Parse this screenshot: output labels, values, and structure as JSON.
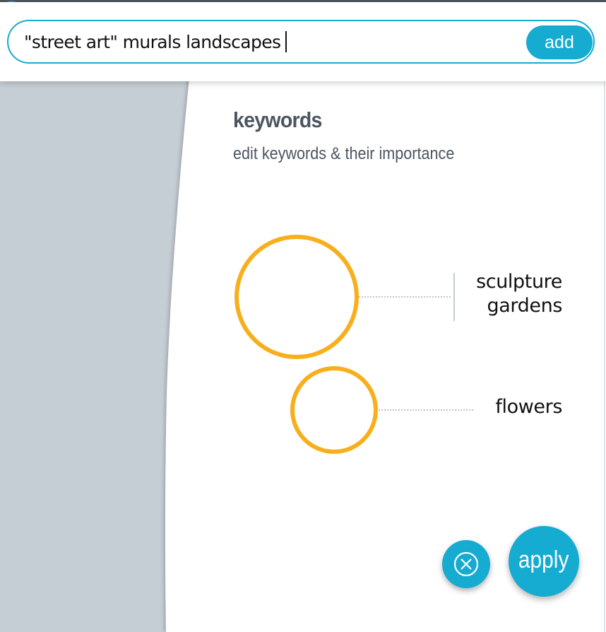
{
  "search": {
    "value": "\"street art\" murals landscapes",
    "add_label": "add"
  },
  "panel": {
    "title": "keywords",
    "subtitle": "edit keywords & their importance",
    "info_icon": "info-icon",
    "close_icon": "close-icon"
  },
  "keywords": [
    {
      "label_line1": "sculpture",
      "label_line2": "gardens",
      "importance": "high"
    },
    {
      "label": "flowers",
      "importance": "medium"
    }
  ],
  "actions": {
    "clear_icon": "clear-circle-x-icon",
    "apply_label": "apply"
  },
  "colors": {
    "accent": "#16abd0",
    "keyword_circle": "#f9ae1b",
    "text_dark": "#4c5660",
    "sidebar_bg": "#c6ced5"
  }
}
